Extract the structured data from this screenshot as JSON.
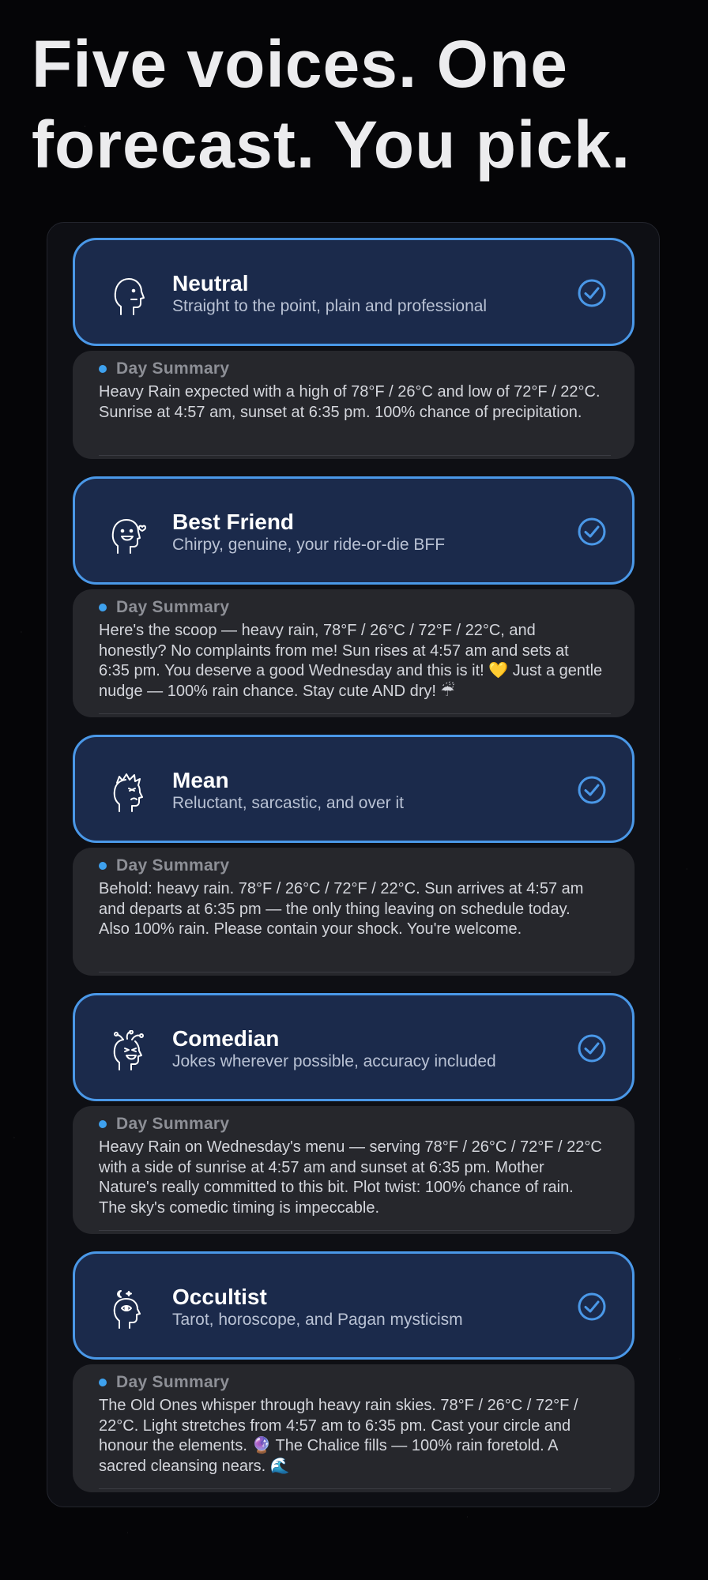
{
  "headline": "Five voices. One forecast. You pick.",
  "colors": {
    "accent": "#4a98e8",
    "card_bg": "#1b2a4b",
    "summary_bg": "#26272c",
    "dot": "#3ea1ee"
  },
  "voices": [
    {
      "name": "Neutral",
      "description": "Straight to the point, plain and professional",
      "icon": "neutral-head-icon",
      "selected": true,
      "summary_label": "Day Summary",
      "summary": "Heavy Rain expected with a high of 78°F / 26°C and low of 72°F / 22°C. Sunrise at 4:57 am, sunset at 6:35 pm. 100% chance of precipitation."
    },
    {
      "name": "Best Friend",
      "description": "Chirpy, genuine, your ride-or-die BFF",
      "icon": "heart-head-icon",
      "selected": true,
      "summary_label": "Day Summary",
      "summary": "Here's the scoop — heavy rain, 78°F / 26°C / 72°F / 22°C, and honestly? No complaints from me! Sun rises at 4:57 am and sets at 6:35 pm. You deserve a good Wednesday and this is it! 💛 Just a gentle nudge — 100% rain chance. Stay cute AND dry! ☔"
    },
    {
      "name": "Mean",
      "description": "Reluctant, sarcastic, and over it",
      "icon": "annoyed-head-icon",
      "selected": true,
      "summary_label": "Day Summary",
      "summary": "Behold: heavy rain. 78°F / 26°C / 72°F / 22°C. Sun arrives at 4:57 am and departs at 6:35 pm — the only thing leaving on schedule today. Also 100% rain. Please contain your shock. You're welcome."
    },
    {
      "name": "Comedian",
      "description": "Jokes wherever possible, accuracy included",
      "icon": "jester-head-icon",
      "selected": true,
      "summary_label": "Day Summary",
      "summary": "Heavy Rain on Wednesday's menu — serving 78°F / 26°C / 72°F / 22°C with a side of sunrise at 4:57 am and sunset at 6:35 pm. Mother Nature's really committed to this bit. Plot twist: 100% chance of rain. The sky's comedic timing is impeccable."
    },
    {
      "name": "Occultist",
      "description": "Tarot, horoscope, and Pagan mysticism",
      "icon": "mystic-head-icon",
      "selected": true,
      "summary_label": "Day Summary",
      "summary": "The Old Ones whisper through heavy rain skies. 78°F / 26°C / 72°F / 22°C. Light stretches from 4:57 am to 6:35 pm. Cast your circle and honour the elements. 🔮 The Chalice fills — 100% rain foretold. A sacred cleansing nears. 🌊"
    }
  ]
}
